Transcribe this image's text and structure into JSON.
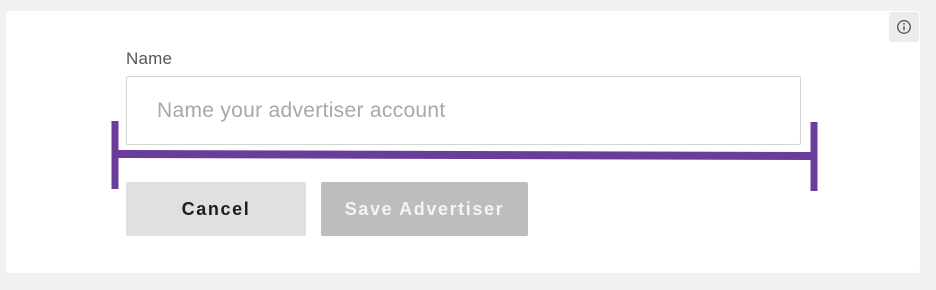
{
  "form": {
    "name_label": "Name",
    "name_value": "",
    "name_placeholder": "Name your advertiser account",
    "cancel_label": "Cancel",
    "save_label": "Save Advertiser",
    "save_enabled": false
  },
  "info_button": {
    "icon": "info-icon"
  },
  "annotation": {
    "shape": "horizontal-bracket",
    "color": "#6a3d9a"
  }
}
